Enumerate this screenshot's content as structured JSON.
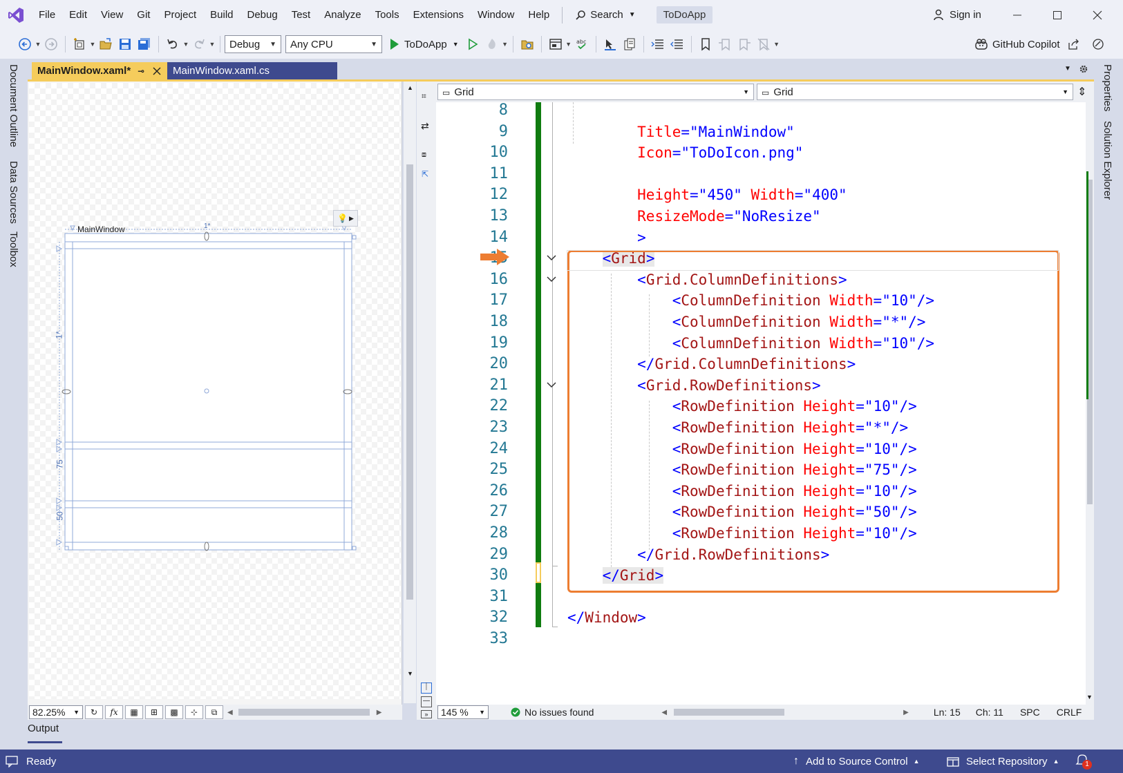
{
  "menubar": {
    "items": [
      "File",
      "Edit",
      "View",
      "Git",
      "Project",
      "Build",
      "Debug",
      "Test",
      "Analyze",
      "Tools",
      "Extensions",
      "Window",
      "Help"
    ],
    "search_label": "Search",
    "app_title": "ToDoApp",
    "signin_label": "Sign in"
  },
  "toolbar": {
    "config": "Debug",
    "platform": "Any CPU",
    "run_target": "ToDoApp",
    "copilot_label": "GitHub Copilot"
  },
  "left_rail": [
    "Document Outline",
    "Data Sources",
    "Toolbox"
  ],
  "right_rail": [
    "Properties",
    "Solution Explorer"
  ],
  "tabs": {
    "active": "MainWindow.xaml*",
    "inactive": "MainWindow.xaml.cs"
  },
  "designer": {
    "window_title": "MainWindow",
    "col_marker": "1*",
    "row_labels": [
      "1*",
      "75",
      "50"
    ],
    "zoom": "82.25%"
  },
  "editor": {
    "nav_left": "Grid",
    "nav_right": "Grid",
    "zoom": "145 %",
    "issues": "No issues found",
    "line": "Ln: 15",
    "char": "Ch: 11",
    "spacing": "SPC",
    "eol": "CRLF",
    "lines": [
      {
        "n": "8",
        "parts": []
      },
      {
        "n": "9",
        "parts": [
          {
            "t": "        "
          },
          {
            "c": "at",
            "t": "Title"
          },
          {
            "c": "pu",
            "t": "=\""
          },
          {
            "c": "vl",
            "t": "MainWindow"
          },
          {
            "c": "pu",
            "t": "\""
          }
        ]
      },
      {
        "n": "10",
        "parts": [
          {
            "t": "        "
          },
          {
            "c": "at",
            "t": "Icon"
          },
          {
            "c": "pu",
            "t": "=\""
          },
          {
            "c": "vl",
            "t": "ToDoIcon.png"
          },
          {
            "c": "pu",
            "t": "\""
          }
        ]
      },
      {
        "n": "11",
        "parts": []
      },
      {
        "n": "12",
        "parts": [
          {
            "t": "        "
          },
          {
            "c": "at",
            "t": "Height"
          },
          {
            "c": "pu",
            "t": "=\""
          },
          {
            "c": "vl",
            "t": "450"
          },
          {
            "c": "pu",
            "t": "\" "
          },
          {
            "c": "at",
            "t": "Width"
          },
          {
            "c": "pu",
            "t": "=\""
          },
          {
            "c": "vl",
            "t": "400"
          },
          {
            "c": "pu",
            "t": "\""
          }
        ]
      },
      {
        "n": "13",
        "parts": [
          {
            "t": "        "
          },
          {
            "c": "at",
            "t": "ResizeMode"
          },
          {
            "c": "pu",
            "t": "=\""
          },
          {
            "c": "vl",
            "t": "NoResize"
          },
          {
            "c": "pu",
            "t": "\""
          }
        ]
      },
      {
        "n": "14",
        "parts": [
          {
            "t": "        "
          },
          {
            "c": "pu",
            "t": ">"
          }
        ]
      },
      {
        "n": "15",
        "parts": [
          {
            "t": "    "
          },
          {
            "c": "pu hl",
            "t": "<"
          },
          {
            "c": "tg hl",
            "t": "Grid"
          },
          {
            "c": "pu hl",
            "t": ">"
          }
        ]
      },
      {
        "n": "16",
        "parts": [
          {
            "t": "        "
          },
          {
            "c": "pu",
            "t": "<"
          },
          {
            "c": "tg",
            "t": "Grid.ColumnDefinitions"
          },
          {
            "c": "pu",
            "t": ">"
          }
        ]
      },
      {
        "n": "17",
        "parts": [
          {
            "t": "            "
          },
          {
            "c": "pu",
            "t": "<"
          },
          {
            "c": "tg",
            "t": "ColumnDefinition"
          },
          {
            "t": " "
          },
          {
            "c": "at",
            "t": "Width"
          },
          {
            "c": "pu",
            "t": "=\""
          },
          {
            "c": "vl",
            "t": "10"
          },
          {
            "c": "pu",
            "t": "\"/>"
          }
        ]
      },
      {
        "n": "18",
        "parts": [
          {
            "t": "            "
          },
          {
            "c": "pu",
            "t": "<"
          },
          {
            "c": "tg",
            "t": "ColumnDefinition"
          },
          {
            "t": " "
          },
          {
            "c": "at",
            "t": "Width"
          },
          {
            "c": "pu",
            "t": "=\""
          },
          {
            "c": "vl",
            "t": "*"
          },
          {
            "c": "pu",
            "t": "\"/>"
          }
        ]
      },
      {
        "n": "19",
        "parts": [
          {
            "t": "            "
          },
          {
            "c": "pu",
            "t": "<"
          },
          {
            "c": "tg",
            "t": "ColumnDefinition"
          },
          {
            "t": " "
          },
          {
            "c": "at",
            "t": "Width"
          },
          {
            "c": "pu",
            "t": "=\""
          },
          {
            "c": "vl",
            "t": "10"
          },
          {
            "c": "pu",
            "t": "\"/>"
          }
        ]
      },
      {
        "n": "20",
        "parts": [
          {
            "t": "        "
          },
          {
            "c": "pu",
            "t": "</"
          },
          {
            "c": "tg",
            "t": "Grid.ColumnDefinitions"
          },
          {
            "c": "pu",
            "t": ">"
          }
        ]
      },
      {
        "n": "21",
        "parts": [
          {
            "t": "        "
          },
          {
            "c": "pu",
            "t": "<"
          },
          {
            "c": "tg",
            "t": "Grid.RowDefinitions"
          },
          {
            "c": "pu",
            "t": ">"
          }
        ]
      },
      {
        "n": "22",
        "parts": [
          {
            "t": "            "
          },
          {
            "c": "pu",
            "t": "<"
          },
          {
            "c": "tg",
            "t": "RowDefinition"
          },
          {
            "t": " "
          },
          {
            "c": "at",
            "t": "Height"
          },
          {
            "c": "pu",
            "t": "=\""
          },
          {
            "c": "vl",
            "t": "10"
          },
          {
            "c": "pu",
            "t": "\"/>"
          }
        ]
      },
      {
        "n": "23",
        "parts": [
          {
            "t": "            "
          },
          {
            "c": "pu",
            "t": "<"
          },
          {
            "c": "tg",
            "t": "RowDefinition"
          },
          {
            "t": " "
          },
          {
            "c": "at",
            "t": "Height"
          },
          {
            "c": "pu",
            "t": "=\""
          },
          {
            "c": "vl",
            "t": "*"
          },
          {
            "c": "pu",
            "t": "\"/>"
          }
        ]
      },
      {
        "n": "24",
        "parts": [
          {
            "t": "            "
          },
          {
            "c": "pu",
            "t": "<"
          },
          {
            "c": "tg",
            "t": "RowDefinition"
          },
          {
            "t": " "
          },
          {
            "c": "at",
            "t": "Height"
          },
          {
            "c": "pu",
            "t": "=\""
          },
          {
            "c": "vl",
            "t": "10"
          },
          {
            "c": "pu",
            "t": "\"/>"
          }
        ]
      },
      {
        "n": "25",
        "parts": [
          {
            "t": "            "
          },
          {
            "c": "pu",
            "t": "<"
          },
          {
            "c": "tg",
            "t": "RowDefinition"
          },
          {
            "t": " "
          },
          {
            "c": "at",
            "t": "Height"
          },
          {
            "c": "pu",
            "t": "=\""
          },
          {
            "c": "vl",
            "t": "75"
          },
          {
            "c": "pu",
            "t": "\"/>"
          }
        ]
      },
      {
        "n": "26",
        "parts": [
          {
            "t": "            "
          },
          {
            "c": "pu",
            "t": "<"
          },
          {
            "c": "tg",
            "t": "RowDefinition"
          },
          {
            "t": " "
          },
          {
            "c": "at",
            "t": "Height"
          },
          {
            "c": "pu",
            "t": "=\""
          },
          {
            "c": "vl",
            "t": "10"
          },
          {
            "c": "pu",
            "t": "\"/>"
          }
        ]
      },
      {
        "n": "27",
        "parts": [
          {
            "t": "            "
          },
          {
            "c": "pu",
            "t": "<"
          },
          {
            "c": "tg",
            "t": "RowDefinition"
          },
          {
            "t": " "
          },
          {
            "c": "at",
            "t": "Height"
          },
          {
            "c": "pu",
            "t": "=\""
          },
          {
            "c": "vl",
            "t": "50"
          },
          {
            "c": "pu",
            "t": "\"/>"
          }
        ]
      },
      {
        "n": "28",
        "parts": [
          {
            "t": "            "
          },
          {
            "c": "pu",
            "t": "<"
          },
          {
            "c": "tg",
            "t": "RowDefinition"
          },
          {
            "t": " "
          },
          {
            "c": "at",
            "t": "Height"
          },
          {
            "c": "pu",
            "t": "=\""
          },
          {
            "c": "vl",
            "t": "10"
          },
          {
            "c": "pu",
            "t": "\"/>"
          }
        ]
      },
      {
        "n": "29",
        "parts": [
          {
            "t": "        "
          },
          {
            "c": "pu",
            "t": "</"
          },
          {
            "c": "tg",
            "t": "Grid.RowDefinitions"
          },
          {
            "c": "pu",
            "t": ">"
          }
        ]
      },
      {
        "n": "30",
        "parts": [
          {
            "t": "    "
          },
          {
            "c": "pu hl",
            "t": "</"
          },
          {
            "c": "tg hl",
            "t": "Grid"
          },
          {
            "c": "pu hl",
            "t": ">"
          }
        ]
      },
      {
        "n": "31",
        "parts": []
      },
      {
        "n": "32",
        "parts": [
          {
            "c": "pu",
            "t": "</"
          },
          {
            "c": "tg",
            "t": "Window"
          },
          {
            "c": "pu",
            "t": ">"
          }
        ]
      },
      {
        "n": "33",
        "parts": []
      }
    ]
  },
  "output": {
    "label": "Output"
  },
  "statusbar": {
    "ready": "Ready",
    "source_control": "Add to Source Control",
    "repository": "Select Repository",
    "notification_count": "1"
  },
  "colors": {
    "accent_tab": "#f5cc5c",
    "status_bar": "#3e4a8e",
    "highlight_box": "#ed7d31",
    "change_bar": "#107c10"
  }
}
